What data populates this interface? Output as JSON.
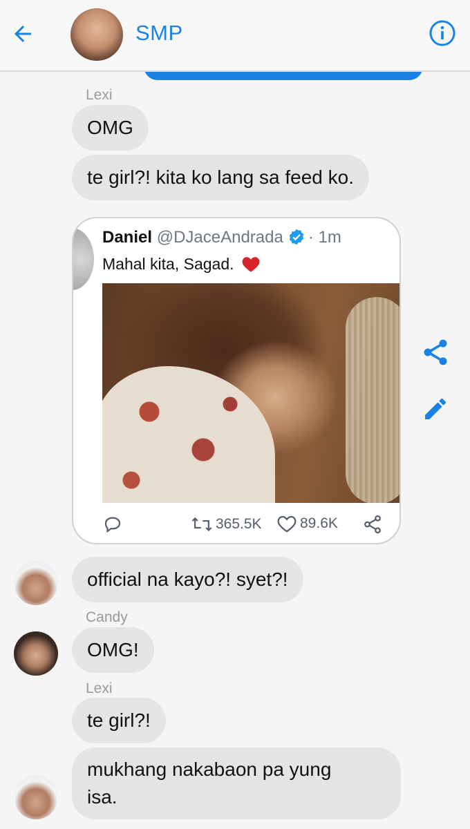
{
  "header": {
    "title": "SMP",
    "back_icon": "arrow-left-icon",
    "info_icon": "info-icon",
    "accent_color": "#1a82e2"
  },
  "messages": [
    {
      "sender": "Lexi",
      "text": "OMG"
    },
    {
      "text": "te girl?! kita ko lang sa feed ko."
    },
    {
      "text": "official na kayo?! syet?!"
    },
    {
      "sender": "Candy",
      "text": "OMG!"
    },
    {
      "sender": "Lexi",
      "text": "te girl?!"
    },
    {
      "text_line1": "mukhang nakabaon pa yung",
      "text_line2": "isa."
    }
  ],
  "tweet": {
    "name": "Daniel",
    "handle": "@DJaceAndrada",
    "time": "· 1m",
    "text": "Mahal kita, Sagad.",
    "retweets": "365.5K",
    "likes": "89.6K"
  },
  "side_actions": {
    "share_icon": "share-icon",
    "edit_icon": "pencil-icon"
  }
}
